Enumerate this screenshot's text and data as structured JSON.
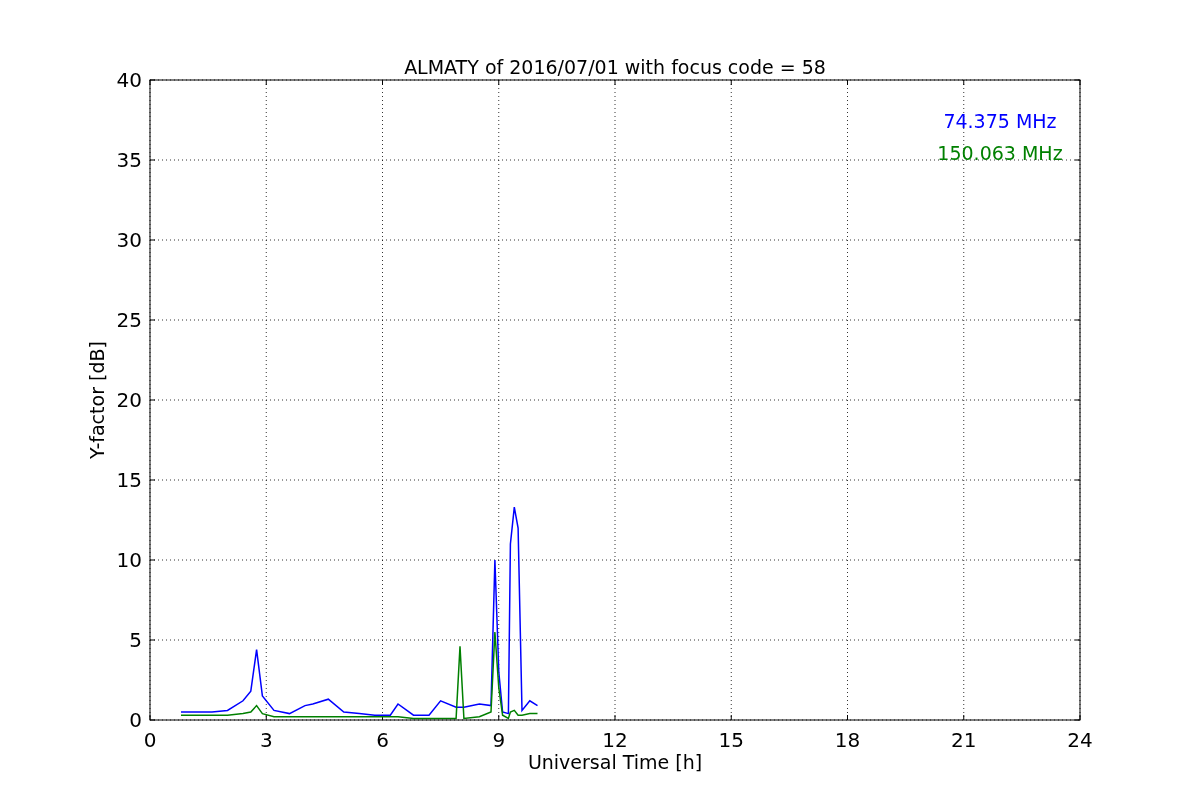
{
  "figure": {
    "chart_data": {
      "type": "line",
      "title": "ALMATY of 2016/07/01 with focus code = 58",
      "xlabel": "Universal Time [h]",
      "ylabel": "Y-factor [dB]",
      "x": [
        0.8,
        1.2,
        1.6,
        2.0,
        2.4,
        2.6,
        2.75,
        2.9,
        3.2,
        3.6,
        4.0,
        4.2,
        4.6,
        5.0,
        5.4,
        5.8,
        6.2,
        6.4,
        6.8,
        7.2,
        7.5,
        7.9,
        8.0,
        8.1,
        8.5,
        8.8,
        8.9,
        9.0,
        9.1,
        9.25,
        9.3,
        9.4,
        9.5,
        9.6,
        9.8,
        10.0
      ],
      "series": [
        {
          "name": "74.375 MHz",
          "color": "#0000ff",
          "values": [
            0.5,
            0.5,
            0.5,
            0.6,
            1.2,
            1.8,
            4.4,
            1.5,
            0.6,
            0.4,
            0.9,
            1.0,
            1.3,
            0.5,
            0.4,
            0.3,
            0.3,
            1.0,
            0.3,
            0.3,
            1.2,
            0.8,
            0.8,
            0.8,
            1.0,
            0.9,
            10.0,
            3.0,
            0.5,
            0.4,
            11.0,
            13.3,
            12.0,
            0.6,
            1.2,
            0.9
          ]
        },
        {
          "name": "150.063 MHz",
          "color": "#008000",
          "values": [
            0.3,
            0.3,
            0.3,
            0.3,
            0.4,
            0.5,
            0.9,
            0.4,
            0.2,
            0.2,
            0.2,
            0.2,
            0.2,
            0.2,
            0.2,
            0.2,
            0.2,
            0.2,
            0.1,
            0.1,
            0.1,
            0.1,
            4.6,
            0.1,
            0.2,
            0.5,
            5.5,
            2.0,
            0.3,
            0.1,
            0.5,
            0.6,
            0.3,
            0.3,
            0.4,
            0.4
          ]
        }
      ],
      "grid": true,
      "xlim": [
        0,
        24
      ],
      "ylim": [
        0,
        40
      ],
      "xticks": [
        0,
        3,
        6,
        9,
        12,
        15,
        18,
        21,
        24
      ],
      "yticks": [
        0,
        5,
        10,
        15,
        20,
        25,
        30,
        35,
        40
      ]
    }
  }
}
